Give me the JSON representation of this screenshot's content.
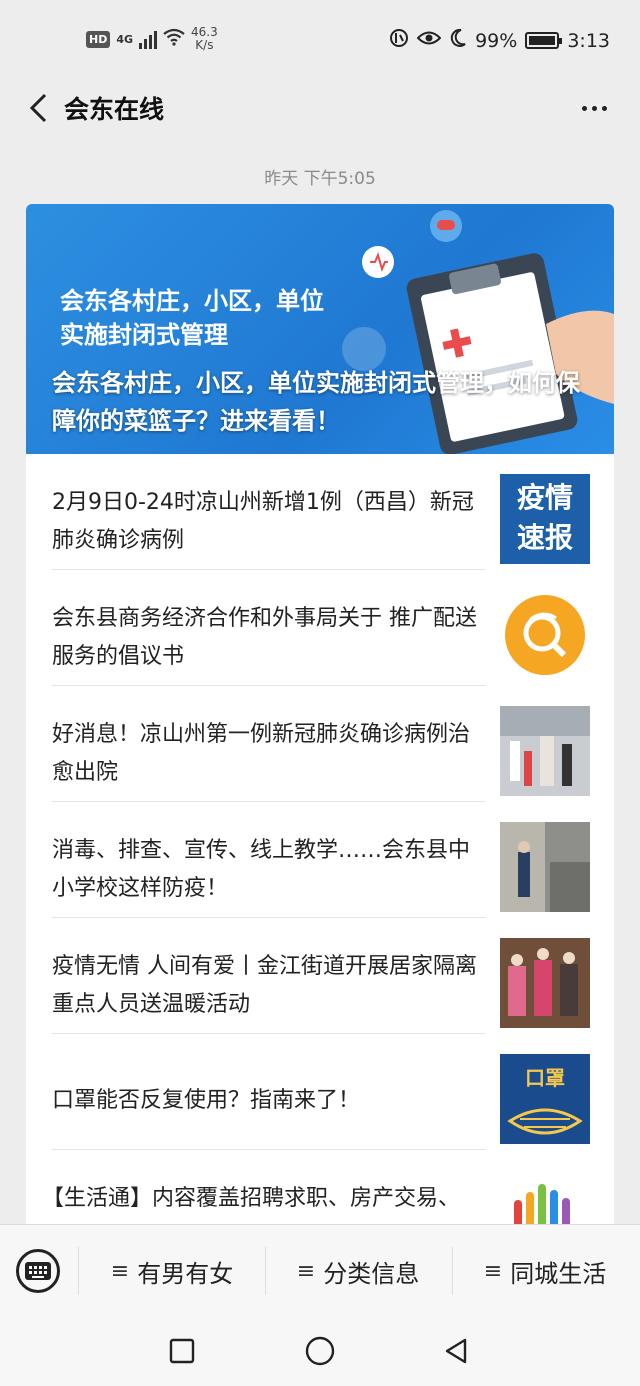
{
  "status_bar": {
    "hd": "HD",
    "network": "4G",
    "speed_value": "46.3",
    "speed_unit": "K/s",
    "battery": "99%",
    "time": "3:13"
  },
  "header": {
    "title": "会东在线"
  },
  "message_time": "昨天 下午5:05",
  "hero": {
    "banner_text": "会东各村庄，小区，单位\n实施封闭式管理",
    "title": "会东各村庄，小区，单位实施封闭式管理，如何保障你的菜篮子？进来看看！"
  },
  "articles": [
    {
      "title": "2月9日0-24时凉山州新增1例（西昌）新冠肺炎确诊病例",
      "thumb_text_1": "疫情",
      "thumb_text_2": "速报"
    },
    {
      "title": "会东县商务经济合作和外事局关于 推广配送服务的倡议书"
    },
    {
      "title": "好消息！凉山州第一例新冠肺炎确诊病例治愈出院"
    },
    {
      "title": "消毒、排查、宣传、线上教学……会东县中小学校这样防疫！"
    },
    {
      "title": "疫情无情 人间有爱丨金江街道开展居家隔离重点人员送温暖活动"
    },
    {
      "title": "口罩能否反复使用？指南来了！",
      "thumb_text_1": "口罩"
    },
    {
      "title": "【生活通】内容覆盖招聘求职、房产交易、"
    }
  ],
  "menu": {
    "items": [
      {
        "label": "有男有女"
      },
      {
        "label": "分类信息"
      },
      {
        "label": "同城生活"
      }
    ]
  },
  "colors": {
    "hero_blue": "#2d8fe0",
    "background": "#ededed",
    "thumb_blue": "#1d5fa8",
    "thumb_orange": "#f5a623"
  }
}
